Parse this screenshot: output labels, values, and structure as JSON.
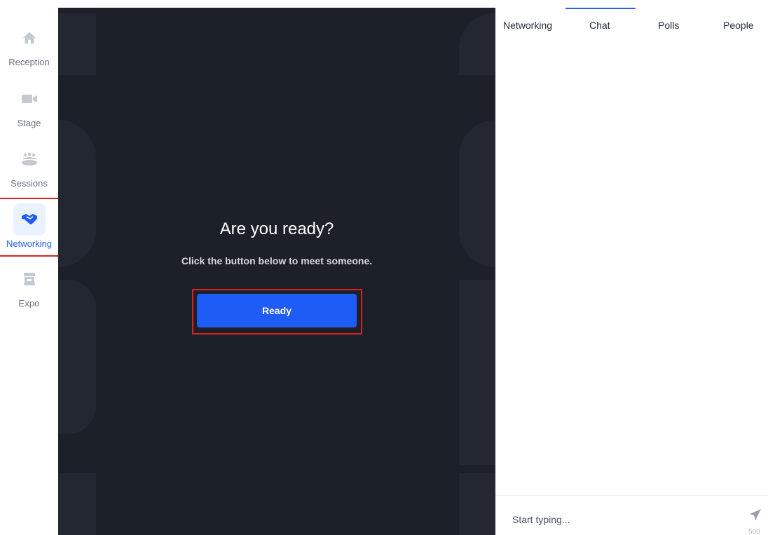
{
  "sidebar": {
    "items": [
      {
        "label": "Reception",
        "icon": "home-icon"
      },
      {
        "label": "Stage",
        "icon": "video-camera-icon"
      },
      {
        "label": "Sessions",
        "icon": "group-icon"
      },
      {
        "label": "Networking",
        "icon": "handshake-icon",
        "active": true
      },
      {
        "label": "Expo",
        "icon": "booth-icon"
      }
    ]
  },
  "stage": {
    "title": "Are you ready?",
    "subtitle": "Click the button below to meet someone.",
    "ready_button": "Ready"
  },
  "panel": {
    "tabs": [
      {
        "label": "Networking"
      },
      {
        "label": "Chat",
        "selected": true
      },
      {
        "label": "Polls"
      },
      {
        "label": "People"
      }
    ],
    "chat": {
      "placeholder": "Start typing...",
      "char_limit": "500"
    }
  },
  "colors": {
    "accent": "#1f5cf6",
    "stage_background": "#1c2029",
    "highlight_outline": "#e01f1f"
  }
}
